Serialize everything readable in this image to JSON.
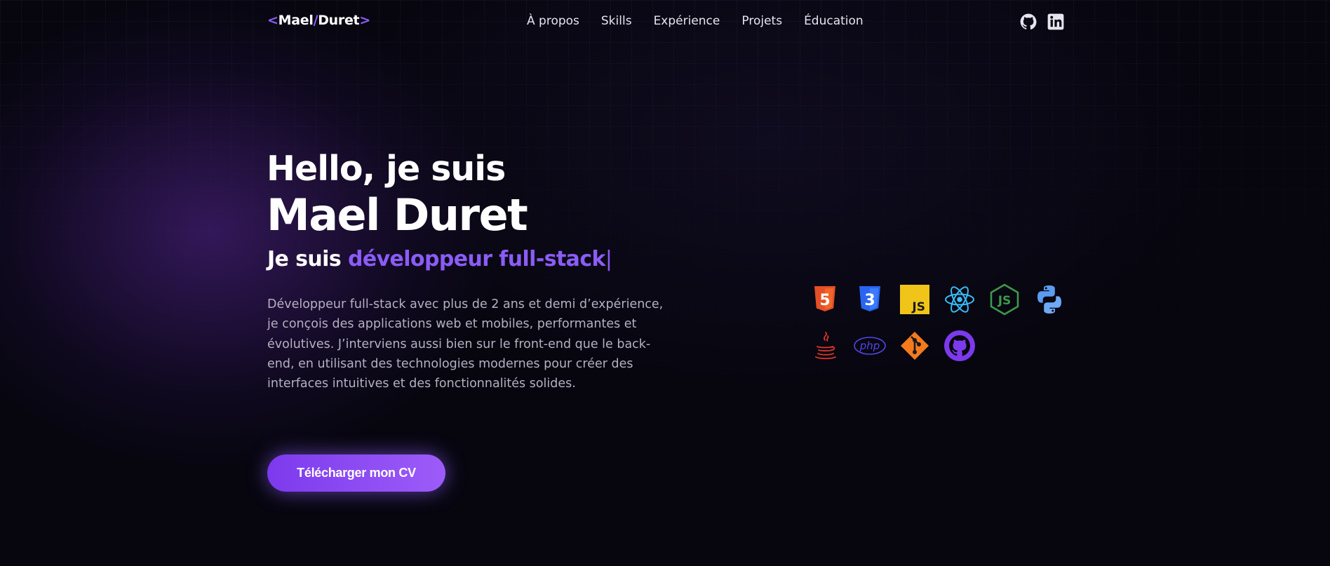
{
  "header": {
    "logo": {
      "open": "<",
      "first": "Mael",
      "slash": "/",
      "last": "Duret",
      "close": ">"
    },
    "nav": [
      "À propos",
      "Skills",
      "Expérience",
      "Projets",
      "Éducation"
    ],
    "social": [
      {
        "icon": "github-icon"
      },
      {
        "icon": "linkedin-icon"
      }
    ]
  },
  "hero": {
    "greeting": "Hello, je suis",
    "name": "Mael Duret",
    "role_prefix": "Je suis ",
    "role_accent": "développeur full-stack",
    "cursor": "|",
    "bio": "Développeur full-stack avec plus de 2 ans et demi d’expérience, je conçois des applications web et mobiles, performantes et évolutives. J’interviens aussi bien sur le front-end que le back-end, en utilisant des technologies modernes pour créer des interfaces intuitives et des fonctionnalités solides.",
    "cta_label": "Télécharger mon CV"
  },
  "skills": [
    {
      "icon": "html5-icon",
      "text": "5",
      "color": "#e34f26"
    },
    {
      "icon": "css3-icon",
      "text": "3",
      "color": "#2965f1"
    },
    {
      "icon": "javascript-icon",
      "text": "JS",
      "color": "#f0c419"
    },
    {
      "icon": "react-icon",
      "color": "#38bdf8"
    },
    {
      "icon": "nodejs-icon",
      "text": "JS",
      "color": "#3c9a48"
    },
    {
      "icon": "python-icon",
      "color": "#5b9bf0"
    },
    {
      "icon": "java-icon",
      "color": "#e0352b"
    },
    {
      "icon": "php-icon",
      "text": "php",
      "color": "#4f46e5"
    },
    {
      "icon": "git-icon",
      "color": "#f37b1d"
    },
    {
      "icon": "github-icon",
      "color": "#7c3aed"
    }
  ],
  "colors": {
    "accent": "#8b5cf6",
    "background": "#07060f"
  }
}
